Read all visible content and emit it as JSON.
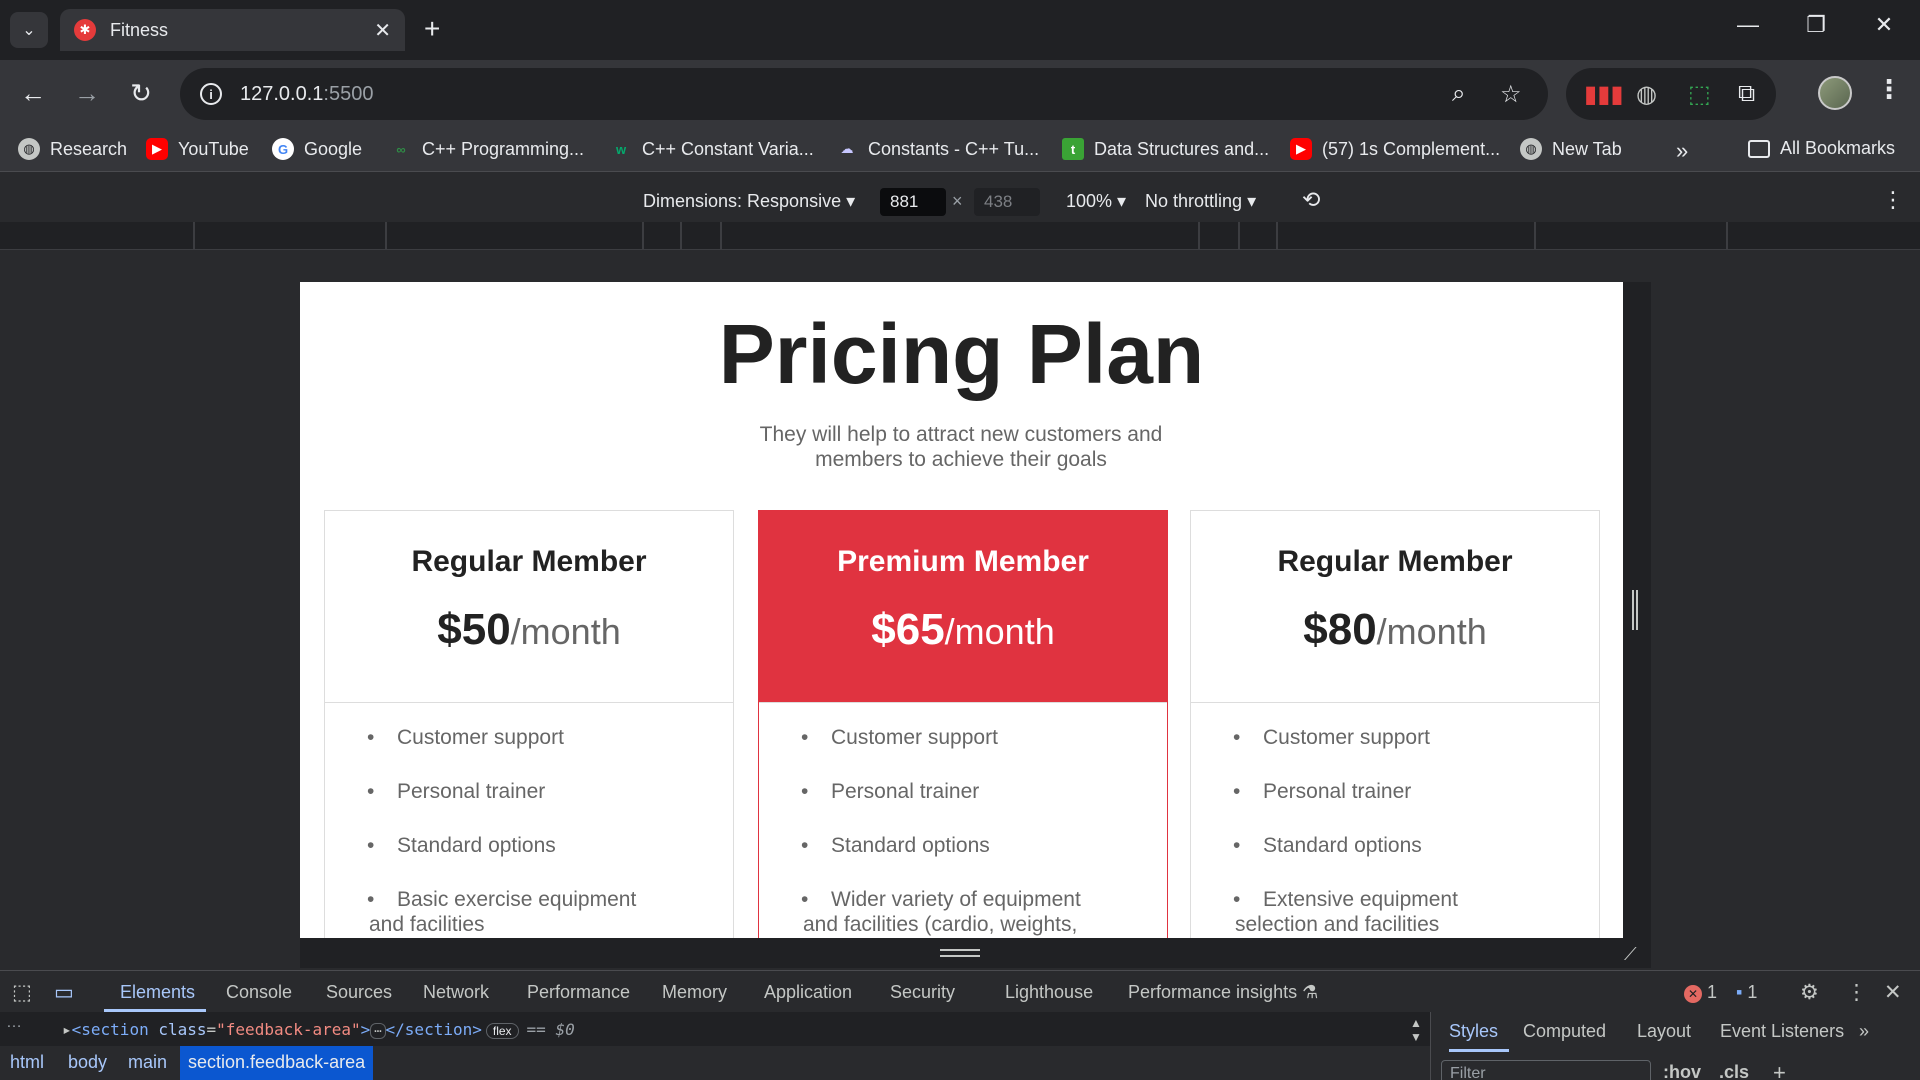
{
  "browser": {
    "tab_title": "Fitness",
    "url_host": "127.0.0.1",
    "url_port": ":5500"
  },
  "bookmarks": [
    {
      "label": "Research",
      "icon": "globe-icon"
    },
    {
      "label": "YouTube",
      "icon": "youtube-icon"
    },
    {
      "label": "Google",
      "icon": "google-icon"
    },
    {
      "label": "C++ Programming...",
      "icon": "gfg-icon"
    },
    {
      "label": "C++ Constant Varia...",
      "icon": "w3-icon"
    },
    {
      "label": "Constants - C++ Tu...",
      "icon": "cplusplus-icon"
    },
    {
      "label": "Data Structures and...",
      "icon": "tutorial-icon"
    },
    {
      "label": "(57) 1s Complement...",
      "icon": "youtube-icon"
    },
    {
      "label": "New Tab",
      "icon": "globe-icon"
    }
  ],
  "bookmarks_all": "All Bookmarks",
  "device_toolbar": {
    "dimensions": "Dimensions: Responsive",
    "width": "881",
    "height": "438",
    "zoom": "100%",
    "throttling": "No throttling"
  },
  "page": {
    "title": "Pricing Plan",
    "subtitle_line1": "They will help to attract new customers and",
    "subtitle_line2": "members to achieve their goals",
    "plans": [
      {
        "name": "Regular Member",
        "amount": "$50",
        "period": "/month",
        "features": [
          "Customer support",
          "Personal trainer",
          "Standard options"
        ],
        "last_feature_line1": "Basic exercise equipment",
        "last_feature_line2": "and facilities"
      },
      {
        "name": "Premium Member",
        "amount": "$65",
        "period": "/month",
        "features": [
          "Customer support",
          "Personal trainer",
          "Standard options"
        ],
        "last_feature_line1": "Wider variety of equipment",
        "last_feature_line2": "and facilities (cardio, weights,"
      },
      {
        "name": "Regular Member",
        "amount": "$80",
        "period": "/month",
        "features": [
          "Customer support",
          "Personal trainer",
          "Standard options"
        ],
        "last_feature_line1": "Extensive equipment",
        "last_feature_line2": "selection and facilities"
      }
    ]
  },
  "devtools": {
    "tabs": [
      "Elements",
      "Console",
      "Sources",
      "Network",
      "Performance",
      "Memory",
      "Application",
      "Security",
      "Lighthouse",
      "Performance insights"
    ],
    "error_count": "1",
    "message_count": "1",
    "dom": {
      "tag_open": "<section",
      "attr_name": "class",
      "attr_value": "\"feedback-area\"",
      "tag_close": "</section>",
      "badge": "flex",
      "ref": "== $0"
    },
    "breadcrumbs": [
      "html",
      "body",
      "main",
      "section.feedback-area"
    ],
    "styles_tabs": [
      "Styles",
      "Computed",
      "Layout",
      "Event Listeners"
    ],
    "filter_placeholder": "Filter",
    "hov": ":hov",
    "cls": ".cls"
  },
  "colors": {
    "accent_red": "#e03340",
    "devtools_blue": "#a8c7fa"
  }
}
